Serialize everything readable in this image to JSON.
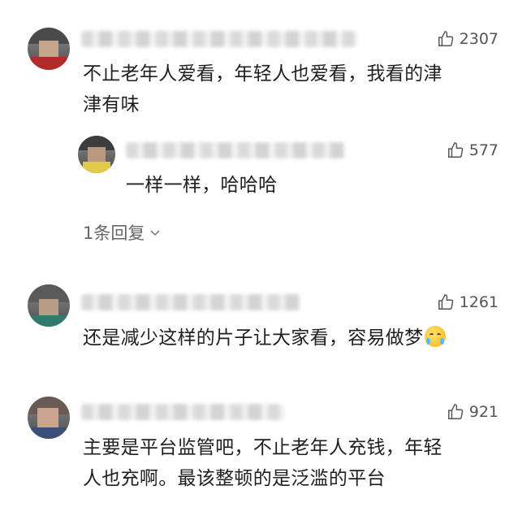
{
  "comments": [
    {
      "likes": "2307",
      "text_line1": "不止老年人爱看，年轻人也爱看，我看的津",
      "text_line2": "津有味"
    },
    {
      "likes": "577",
      "text_line1": "一样一样，哈哈哈"
    },
    {
      "likes": "1261",
      "text_line1": "还是减少这样的片子让大家看，容易做梦",
      "emoji": "crying-laughing-emoji"
    },
    {
      "likes": "921",
      "text_line1": "主要是平台监管吧，不止老年人充钱，年轻",
      "text_line2": "人也充啊。最该整顿的是泛滥的平台"
    }
  ],
  "replies_toggle": "1条回复",
  "icons": {
    "like": "thumbs-up-icon",
    "expand": "chevron-down-icon"
  }
}
